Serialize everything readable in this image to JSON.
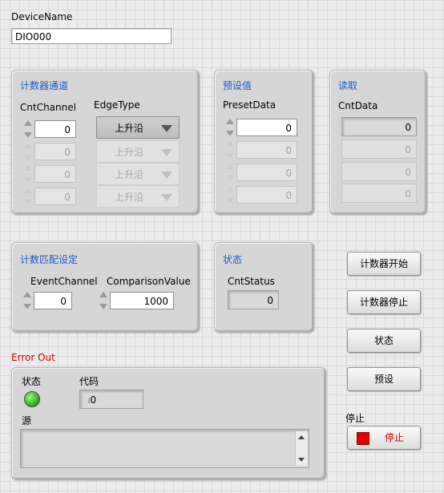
{
  "device": {
    "label": "DeviceName",
    "value": "DIO000"
  },
  "counter_channel_panel": {
    "title": "计数器通道",
    "cnt_channel_label": "CntChannel",
    "edge_type_label": "EdgeType",
    "cnt_channels": [
      "0",
      "0",
      "0",
      "0"
    ],
    "edge_types": [
      "上升沿",
      "上升沿",
      "上升沿",
      "上升沿"
    ]
  },
  "preset_panel": {
    "title": "预设值",
    "label": "PresetData",
    "values": [
      "0",
      "0",
      "0",
      "0"
    ]
  },
  "read_panel": {
    "title": "读取",
    "label": "CntData",
    "values": [
      "0",
      "0",
      "0",
      "0"
    ]
  },
  "match_panel": {
    "title": "计数匹配设定",
    "event_channel_label": "EventChannel",
    "event_channel_value": "0",
    "comparison_label": "ComparisonValue",
    "comparison_value": "1000"
  },
  "status_panel": {
    "title": "状态",
    "label": "CntStatus",
    "value": "0"
  },
  "buttons": {
    "start": "计数器开始",
    "stop_counter": "计数器停止",
    "status": "状态",
    "preset": "预设"
  },
  "stop": {
    "label": "停止",
    "button_text": "停止",
    "color": "#e00000"
  },
  "error_out": {
    "title": "Error Out",
    "status_label": "状态",
    "code_label": "代码",
    "code_value": "0",
    "source_label": "源",
    "status_color": "#3ab02b"
  }
}
